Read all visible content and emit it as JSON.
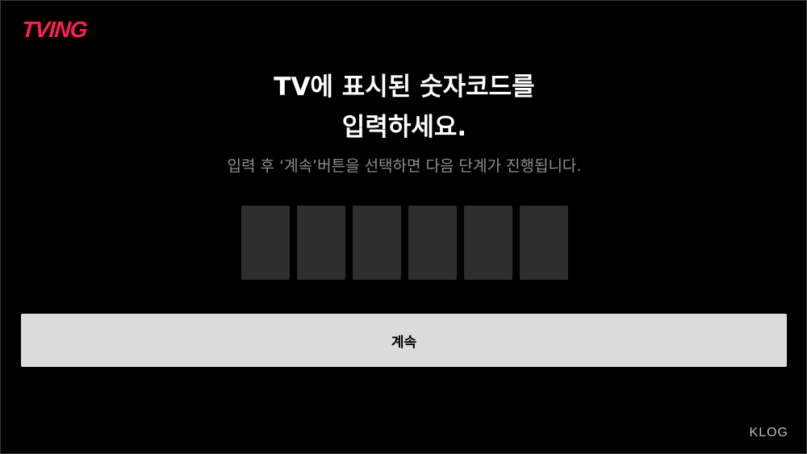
{
  "header": {
    "logo_text": "TVING",
    "logo_color": "#ff1f4b"
  },
  "main": {
    "title_line1": "TV에 표시된 숫자코드를",
    "title_line2": "입력하세요.",
    "subtitle": "입력 후 ‘계속’버튼을 선택하면 다음 단계가 진행됩니다.",
    "code_boxes": [
      "",
      "",
      "",
      "",
      "",
      ""
    ],
    "continue_label": "계속"
  },
  "footer": {
    "watermark": "KLOG"
  }
}
